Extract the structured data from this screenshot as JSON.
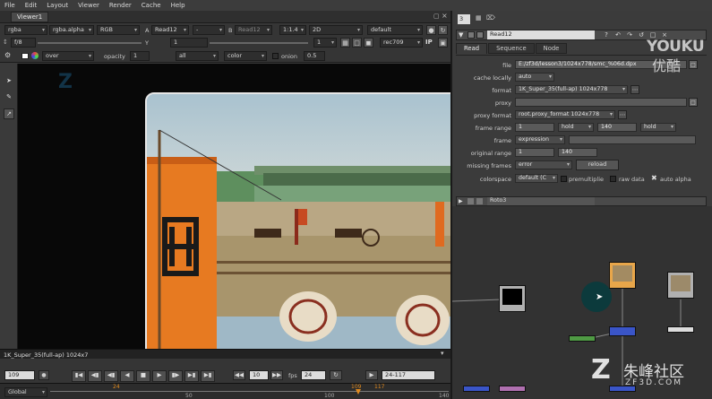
{
  "menu": [
    "File",
    "Edit",
    "Layout",
    "Viewer",
    "Render",
    "Cache",
    "Help"
  ],
  "viewer": {
    "tab": "Viewer1",
    "channels": "rgba",
    "alpha": "rgba.alpha",
    "colorspace": "RGB",
    "input_a_label": "A",
    "input_a": "Read12",
    "input_a_op": "-",
    "input_b_label": "B",
    "input_b": "Read12",
    "zoom": "1:1.4",
    "view_mode": "2D",
    "lut": "default",
    "fstop": "f/8",
    "gain": "1",
    "gamma_label": "Y",
    "gamma": "1",
    "proxy_scale": "1",
    "display_lut": "rec709",
    "ip": "IP",
    "composite": "over",
    "opacity_label": "opacity",
    "opacity": "1",
    "mask_channel": "all",
    "overlay": "color",
    "onion_label": "onion",
    "onion": "0.5",
    "format_text": "1K_Super_35(full-ap) 1024x7",
    "frame": "109",
    "step_count": "10",
    "fps_label": "fps",
    "fps": "24",
    "range": "24-117",
    "view_scope": "Global",
    "timeline": {
      "start": "24",
      "current": "109",
      "end": "117",
      "tick_50": "50",
      "tick_100": "100",
      "tick_140": "140"
    }
  },
  "properties": {
    "count": "3",
    "node_name": "Read12",
    "tabs": [
      "Read",
      "Sequence",
      "Node"
    ],
    "file_label": "file",
    "file": "E:/zf3d/lesson3/1024x778/smc_%06d.dpx",
    "cache_label": "cache locally",
    "cache": "auto",
    "format_label": "format",
    "format": "1K_Super_35(full-ap) 1024x778",
    "proxy_label": "proxy",
    "proxy": "",
    "proxy_format_label": "proxy format",
    "proxy_format": "root.proxy_format 1024x778",
    "frame_range_label": "frame range",
    "frame_first": "1",
    "before": "hold",
    "frame_last": "140",
    "after": "hold",
    "frame_label": "frame",
    "frame_mode": "expression",
    "frame_value": "",
    "original_range_label": "original range",
    "orig_first": "1",
    "orig_last": "140",
    "missing_label": "missing frames",
    "missing": "error",
    "reload": "reload",
    "colorspace_label": "colorspace",
    "colorspace": "default (C",
    "premultiplied": "premultiplie",
    "raw_data": "raw data",
    "auto_alpha": "auto alpha",
    "roto_name": "Roto3"
  },
  "watermark": {
    "youku": "YOUKU",
    "youku_cn": "优酷",
    "site_cn": "朱峰社区",
    "site": "ZF3D.COM"
  },
  "colors": {
    "accent_orange": "#e08a1e",
    "node_blue": "#3a55c8",
    "node_green": "#4f9a44",
    "node_pink": "#b070b0"
  },
  "icons": [
    "arrow-icon",
    "brush-icon",
    "transform-icon",
    "play-icon",
    "stop-icon",
    "gear-icon",
    "close-icon",
    "checkbox-icon"
  ]
}
